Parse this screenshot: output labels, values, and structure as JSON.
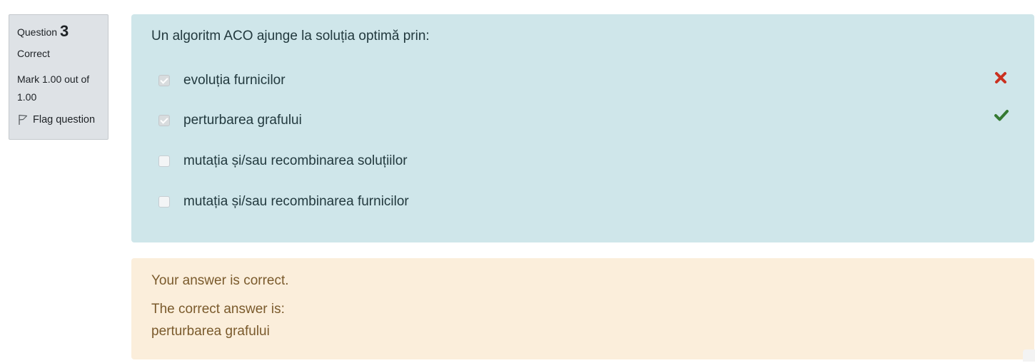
{
  "info": {
    "question_label": "Question",
    "question_number": "3",
    "state": "Correct",
    "grade": "Mark 1.00 out of 1.00",
    "flag_label": "Flag question"
  },
  "question": {
    "text": "Un algoritm ACO ajunge la soluția optimă prin:",
    "answers": [
      {
        "label": "evoluția furnicilor",
        "checked": true,
        "result": "incorrect",
        "result_icon": "cross-icon",
        "result_color": "#ca3120"
      },
      {
        "label": "perturbarea grafului",
        "checked": true,
        "result": "correct",
        "result_icon": "check-icon",
        "result_color": "#357a32"
      },
      {
        "label": "mutația și/sau recombinarea soluțiilor",
        "checked": false
      },
      {
        "label": "mutația și/sau recombinarea furnicilor",
        "checked": false
      }
    ]
  },
  "feedback": {
    "general": "Your answer is correct.",
    "right_answer_label": "The correct answer is:",
    "right_answer_value": "perturbarea grafului"
  },
  "colors": {
    "formulation_bg": "#cfe6ea",
    "feedback_bg": "#fbeedb",
    "info_bg": "#dee2e6"
  }
}
